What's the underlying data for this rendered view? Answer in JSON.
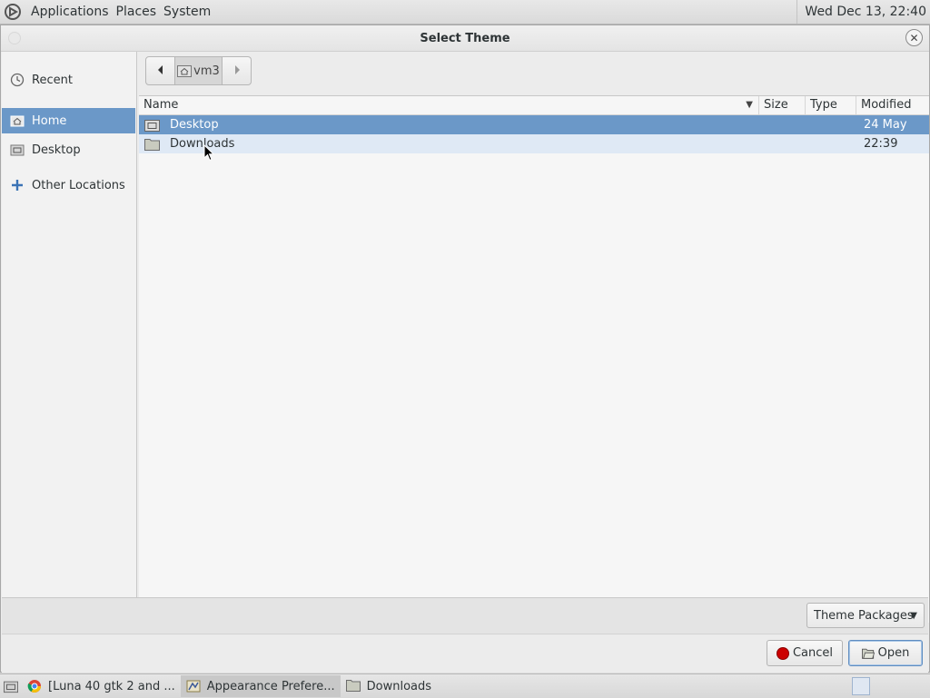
{
  "top_panel": {
    "menus": [
      "Applications",
      "Places",
      "System"
    ],
    "clock": "Wed Dec 13, 22:40"
  },
  "dialog": {
    "title": "Select Theme"
  },
  "sidebar": {
    "items": [
      {
        "label": "Recent",
        "icon": "clock-icon"
      },
      {
        "label": "Home",
        "icon": "home-folder-icon",
        "active": true
      },
      {
        "label": "Desktop",
        "icon": "desktop-folder-icon"
      },
      {
        "label": "Other Locations",
        "icon": "plus-icon"
      }
    ]
  },
  "pathbar": {
    "current": "vm3"
  },
  "file_list": {
    "columns": [
      "Name",
      "Size",
      "Type",
      "Modified"
    ],
    "rows": [
      {
        "name": "Desktop",
        "size": "",
        "type": "",
        "modified": "24 May",
        "selected": true
      },
      {
        "name": "Downloads",
        "size": "",
        "type": "",
        "modified": "22:39",
        "hover": true
      }
    ]
  },
  "filter": {
    "selected": "Theme Packages"
  },
  "actions": {
    "cancel": "Cancel",
    "open": "Open"
  },
  "taskbar": {
    "tasks": [
      {
        "label": "[Luna 40 gtk 2 and ...",
        "icon": "browser-icon"
      },
      {
        "label": "Appearance Prefere...",
        "icon": "appearance-icon"
      },
      {
        "label": "Downloads",
        "icon": "folder-icon"
      }
    ]
  },
  "colors": {
    "selection": "#6b98c8",
    "hover_row": "#dfe9f5",
    "cancel_red": "#cc0000"
  }
}
